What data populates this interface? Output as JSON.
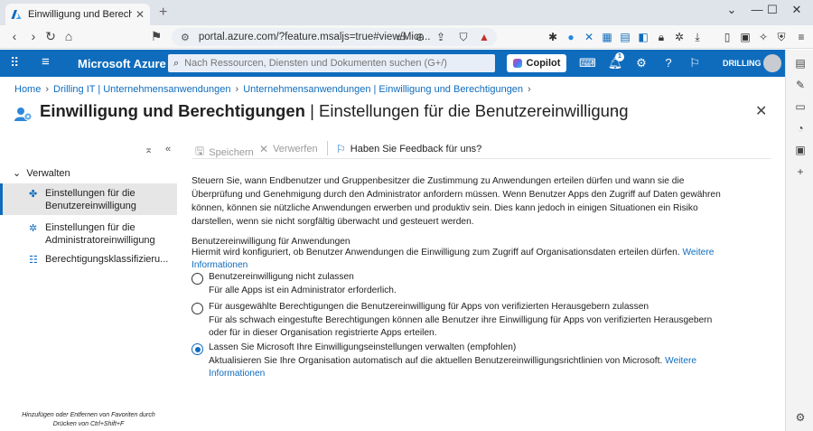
{
  "browser": {
    "tab_title": "Einwilligung und Berechtigungen",
    "new_tab": "+",
    "url": "portal.azure.com/?feature.msaljs=true#view/Micr..."
  },
  "azure": {
    "brand": "Microsoft Azure",
    "search_placeholder": "Nach Ressourcen, Diensten und Dokumenten suchen (G+/)",
    "copilot_label": "Copilot",
    "notification_count": "1",
    "user_name": "DRILLING IT"
  },
  "breadcrumb": [
    "Home",
    "Drilling IT | Unternehmensanwendungen",
    "Unternehmensanwendungen | Einwilligung und Berechtigungen"
  ],
  "page": {
    "title_bold": "Einwilligung und Berechtigungen",
    "title_rest": " | Einstellungen für die Benutzereinwilligung",
    "more": "···"
  },
  "leftnav": {
    "group_label": "Verwalten",
    "items": [
      "Einstellungen für die Benutzereinwilligung",
      "Einstellungen für die Administratoreinwilligung",
      "Berechtigungsklassifizieru..."
    ],
    "favorites_note": "Hinzufügen oder Entfernen von Favoriten durch Drücken von Ctrl+Shift+F"
  },
  "toolbar": {
    "save": "Speichern",
    "discard": "Verwerfen",
    "feedback": "Haben Sie Feedback für uns?"
  },
  "content": {
    "intro": "Steuern Sie, wann Endbenutzer und Gruppenbesitzer die Zustimmung zu Anwendungen erteilen dürfen und wann sie die Überprüfung und Genehmigung durch den Administrator anfordern müssen. Wenn Benutzer Apps den Zugriff auf Daten gewähren können, können sie nützliche Anwendungen erwerben und produktiv sein. Dies kann jedoch in einigen Situationen ein Risiko darstellen, wenn sie nicht sorgfältig überwacht und gesteuert werden.",
    "section_title": "Benutzereinwilligung für Anwendungen",
    "section_desc": "Hiermit wird konfiguriert, ob Benutzer Anwendungen die Einwilligung zum Zugriff auf Organisationsdaten erteilen dürfen.",
    "more_info_link": "Weitere Informationen",
    "options": [
      {
        "label": "Benutzereinwilligung nicht zulassen",
        "desc": "Für alle Apps ist ein Administrator erforderlich.",
        "selected": false
      },
      {
        "label": "Für ausgewählte Berechtigungen die Benutzereinwilligung für Apps von verifizierten Herausgebern zulassen",
        "desc": "Für als schwach eingestufte Berechtigungen können alle Benutzer ihre Einwilligung für Apps von verifizierten Herausgebern oder für in dieser Organisation registrierte Apps erteilen.",
        "selected": false
      },
      {
        "label": "Lassen Sie Microsoft Ihre Einwilligungseinstellungen verwalten (empfohlen)",
        "desc": "Aktualisieren Sie Ihre Organisation automatisch auf die aktuellen Benutzereinwilligungsrichtlinien von Microsoft.",
        "link": "Weitere Informationen",
        "selected": true
      }
    ]
  },
  "colors": {
    "azure_blue": "#0f6cbd"
  }
}
